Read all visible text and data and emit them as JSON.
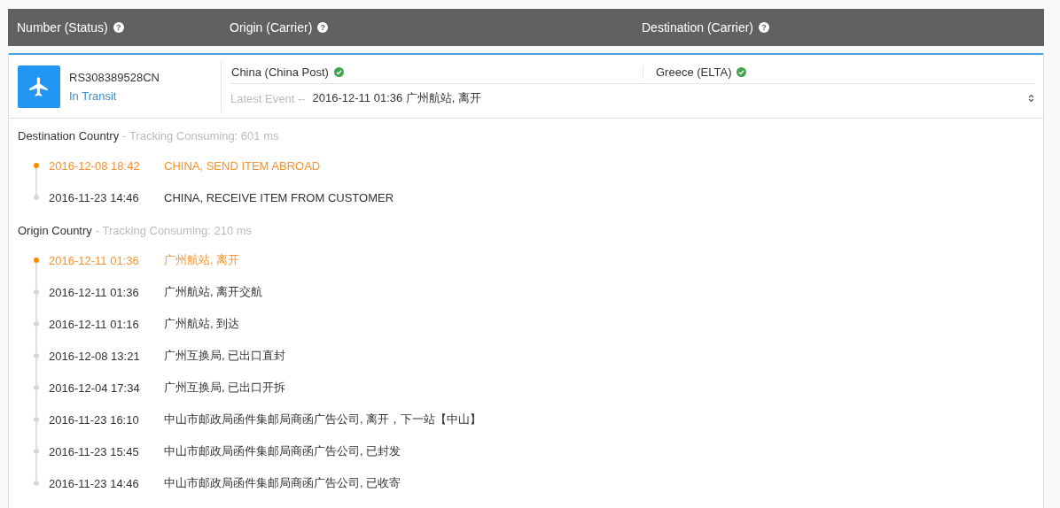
{
  "table": {
    "columns": [
      {
        "label": "Number (Status)",
        "help": "?"
      },
      {
        "label": "Origin (Carrier)",
        "help": "?"
      },
      {
        "label": "Destination (Carrier)",
        "help": "?"
      }
    ]
  },
  "shipment": {
    "number": "RS308389528CN",
    "status": "In Transit",
    "origin": {
      "label": "China (China Post)",
      "verified": true
    },
    "destination": {
      "label": "Greece (ELTA)",
      "verified": true
    },
    "latest_event_label": "Latest Event --",
    "latest_event": "2016-12-11 01:36 广州航站, 离开",
    "expanded": true
  },
  "sections": [
    {
      "title": "Destination Country",
      "timing": "- Tracking Consuming: 601 ms",
      "events": [
        {
          "time": "2016-12-08 18:42",
          "text": "CHINA, SEND ITEM ABROAD",
          "latest": true
        },
        {
          "time": "2016-11-23 14:46",
          "text": "CHINA, RECEIVE ITEM FROM CUSTOMER",
          "latest": false
        }
      ]
    },
    {
      "title": "Origin Country",
      "timing": "- Tracking Consuming: 210 ms",
      "events": [
        {
          "time": "2016-12-11 01:36",
          "text": "广州航站, 离开",
          "latest": true
        },
        {
          "time": "2016-12-11 01:36",
          "text": "广州航站, 离开交航",
          "latest": false
        },
        {
          "time": "2016-12-11 01:16",
          "text": "广州航站, 到达",
          "latest": false
        },
        {
          "time": "2016-12-08 13:21",
          "text": "广州互换局, 已出口直封",
          "latest": false
        },
        {
          "time": "2016-12-04 17:34",
          "text": "广州互换局, 已出口开拆",
          "latest": false
        },
        {
          "time": "2016-11-23 16:10",
          "text": "中山市邮政局函件集邮局商函广告公司, 离开，下一站【中山】",
          "latest": false
        },
        {
          "time": "2016-11-23 15:45",
          "text": "中山市邮政局函件集邮局商函广告公司, 已封发",
          "latest": false
        },
        {
          "time": "2016-11-23 14:46",
          "text": "中山市邮政局函件集邮局商函广告公司, 已收寄",
          "latest": false
        }
      ]
    }
  ]
}
